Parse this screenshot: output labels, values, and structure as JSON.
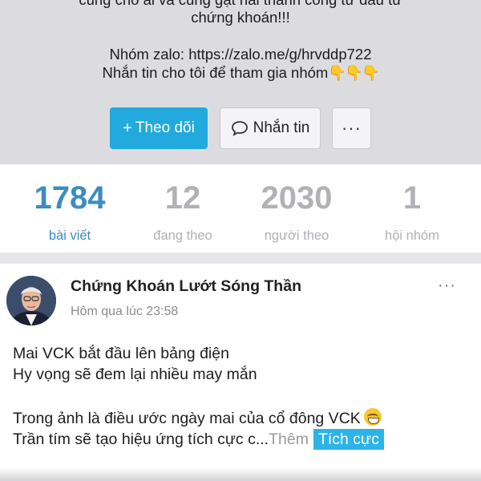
{
  "profile": {
    "bio_line1": "cùng cho ai và cùng gặt hái thành công từ đầu tư",
    "bio_line2": "chứng khoán!!!",
    "bio_line3": "Nhóm zalo: https://zalo.me/g/hrvddp722",
    "bio_line4": "Nhắn tin cho tôi để tham gia nhóm",
    "bio_emoji": "👇👇👇"
  },
  "actions": {
    "follow_plus": "+",
    "follow_label": "Theo dõi",
    "message_label": "Nhắn tin",
    "more_label": "···",
    "icons": {
      "message": "chat-bubble-icon",
      "more": "more-dots-icon"
    }
  },
  "stats": [
    {
      "value": "1784",
      "label": "bài viết",
      "active": true
    },
    {
      "value": "12",
      "label": "đang theo",
      "active": false
    },
    {
      "value": "2030",
      "label": "người theo",
      "active": false
    },
    {
      "value": "1",
      "label": "hội nhóm",
      "active": false
    }
  ],
  "post": {
    "author": "Chứng Khoán Lướt Sóng Thần",
    "time": "Hôm qua lúc 23:58",
    "more_label": "···",
    "line1": "Mai VCK bắt đầu lên bảng điện",
    "line2": "Hy vọng sẽ đem lại nhiều may mắn",
    "line3": "Trong ảnh là điều ước ngày mai của cổ đông VCK",
    "line4": "Trần tím sẽ tạo hiệu ứng tích cực c...",
    "more_link": "Thêm",
    "tag": "Tích cực"
  },
  "colors": {
    "accent": "#22aadf",
    "active_stat": "#3d8cbf",
    "inactive_stat": "#b1b1b6",
    "header_bg": "#dcdce0"
  }
}
